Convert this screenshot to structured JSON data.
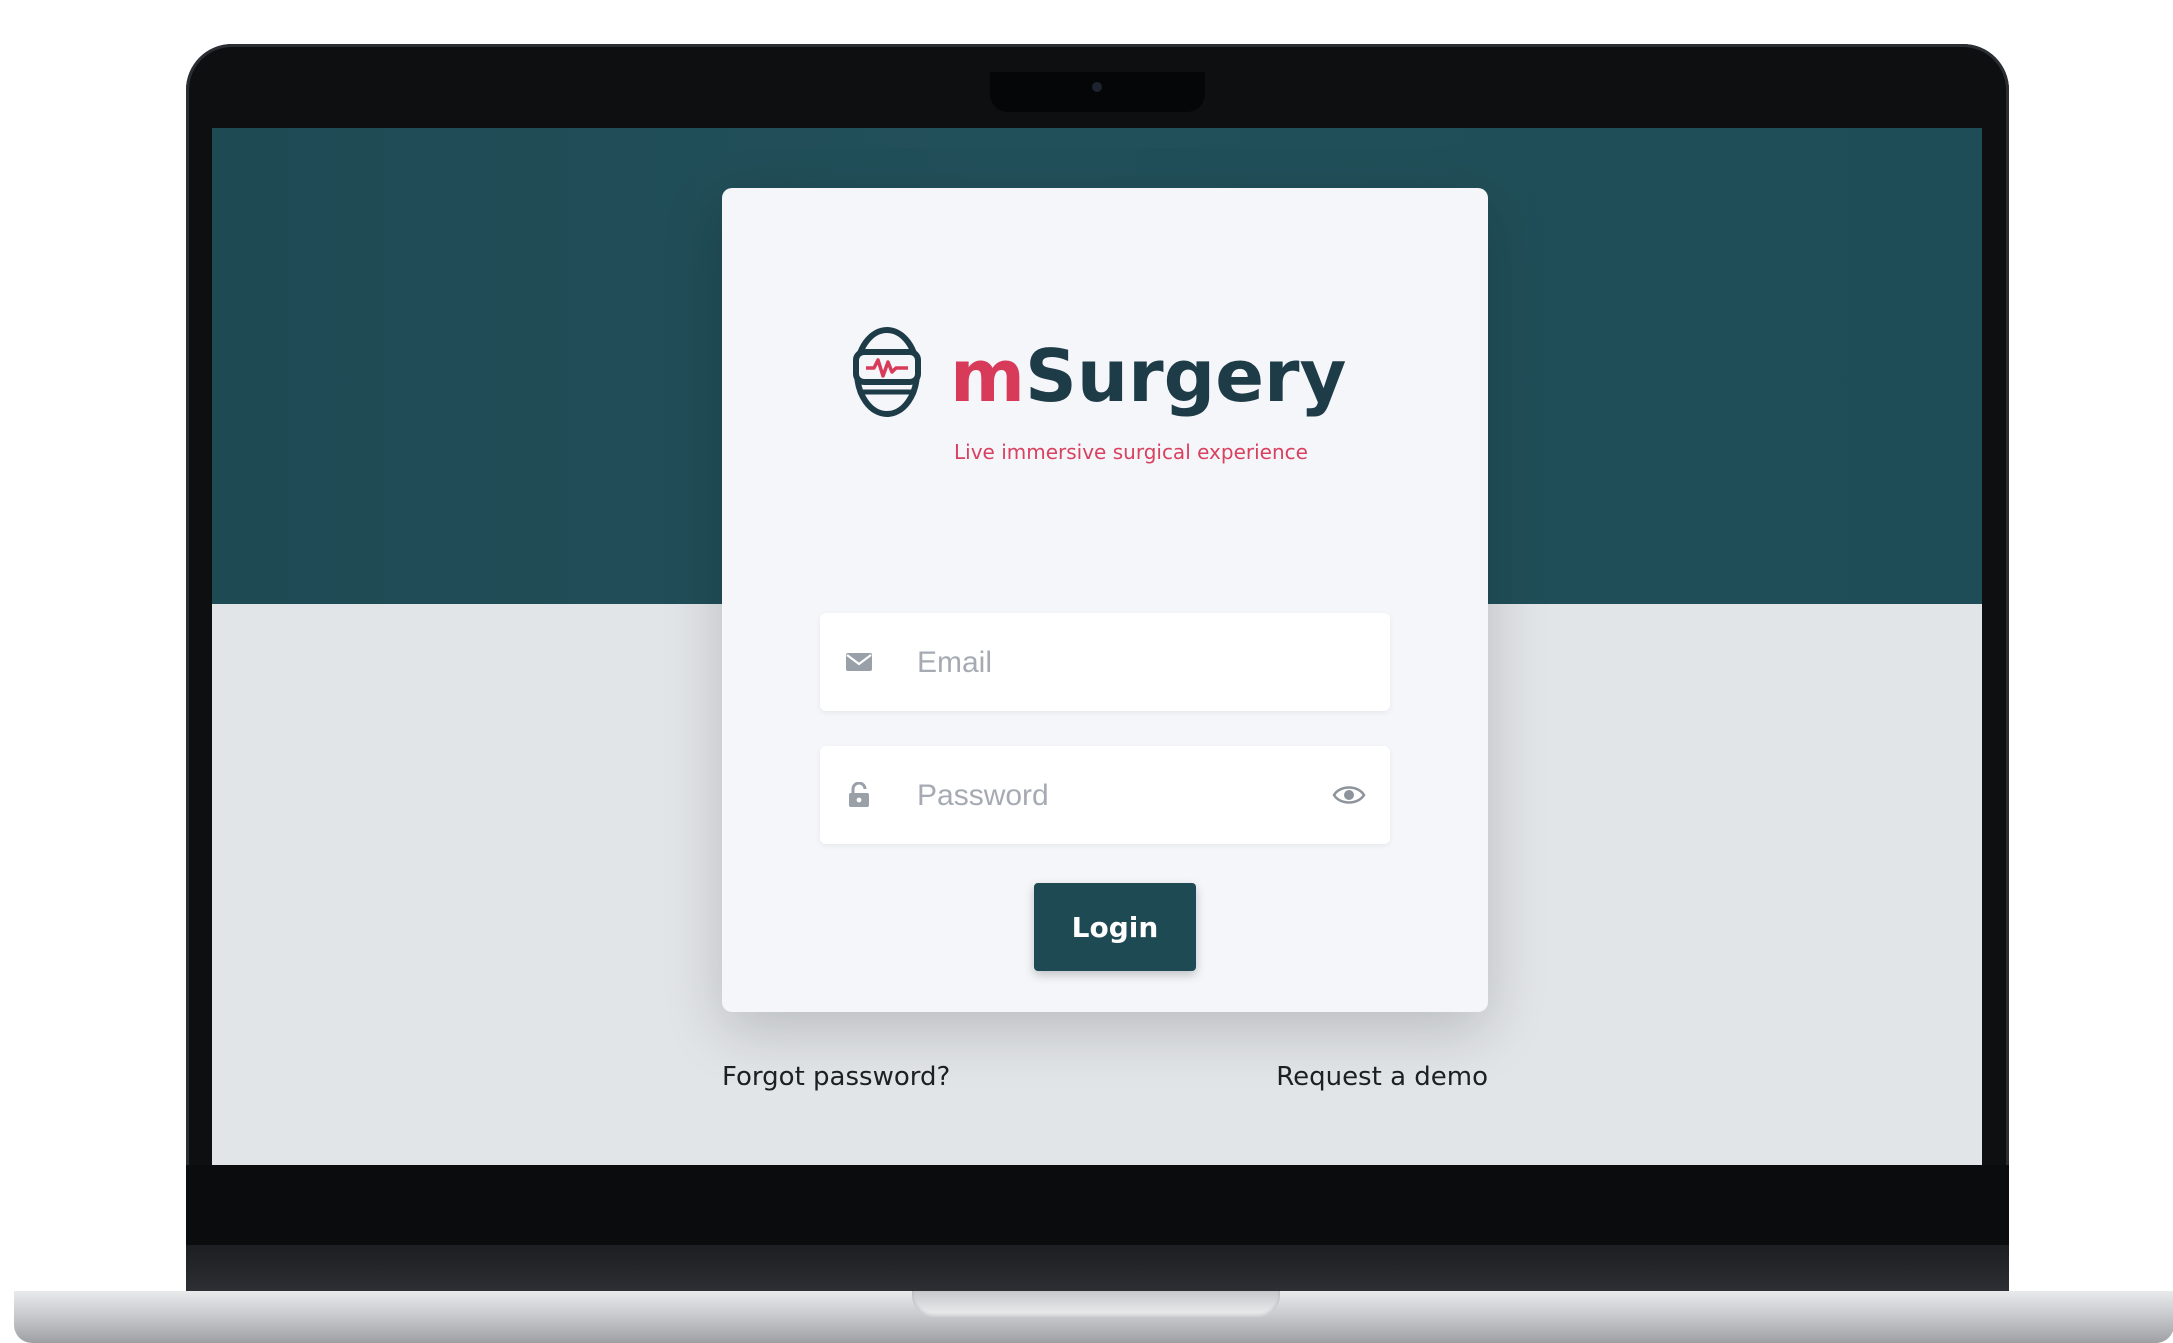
{
  "brand": {
    "name_prefix": "m",
    "name_rest": "Surgery",
    "tagline": "Live immersive surgical experience",
    "colors": {
      "accent": "#d83a5a",
      "primary": "#1e4a54"
    }
  },
  "form": {
    "email": {
      "placeholder": "Email",
      "icon": "envelope-icon"
    },
    "password": {
      "placeholder": "Password",
      "icon": "lock-icon",
      "toggle_icon": "eye-icon"
    },
    "login_label": "Login"
  },
  "links": {
    "forgot_password": "Forgot password?",
    "request_demo": "Request a demo"
  }
}
